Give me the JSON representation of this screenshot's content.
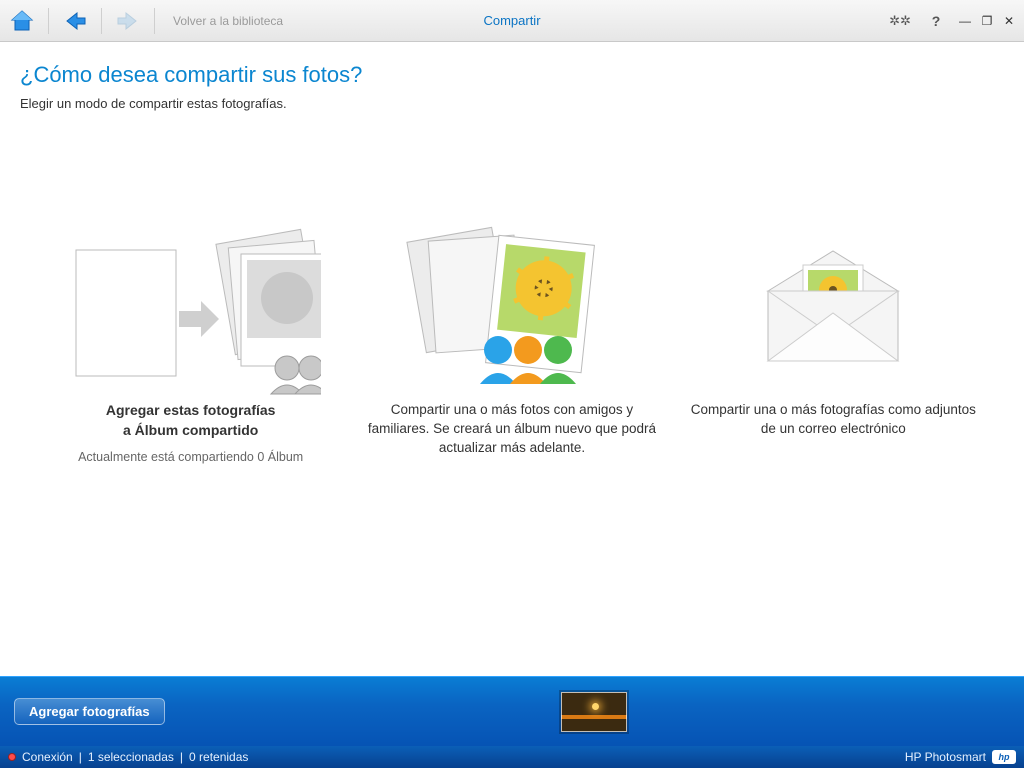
{
  "toolbar": {
    "back_to_library": "Volver a la biblioteca",
    "tab": "Compartir"
  },
  "page": {
    "title": "¿Cómo desea compartir sus fotos?",
    "subtitle": "Elegir un modo de compartir estas fotografías."
  },
  "options": {
    "add_to_album": {
      "line1": "Agregar estas fotografías",
      "line2": "a Álbum compartido",
      "note": "Actualmente está compartiendo 0 Álbum"
    },
    "share_friends": {
      "text": "Compartir una o más fotos con amigos y familiares. Se creará un álbum nuevo que podrá actualizar más adelante."
    },
    "email": {
      "text": "Compartir una o más fotografías como adjuntos de un correo electrónico"
    }
  },
  "tray": {
    "add_button": "Agregar fotografías"
  },
  "status": {
    "connection": "Conexión",
    "selected": "1 seleccionadas",
    "retained": "0 retenidas",
    "brand": "HP Photosmart",
    "badge": "hp"
  }
}
